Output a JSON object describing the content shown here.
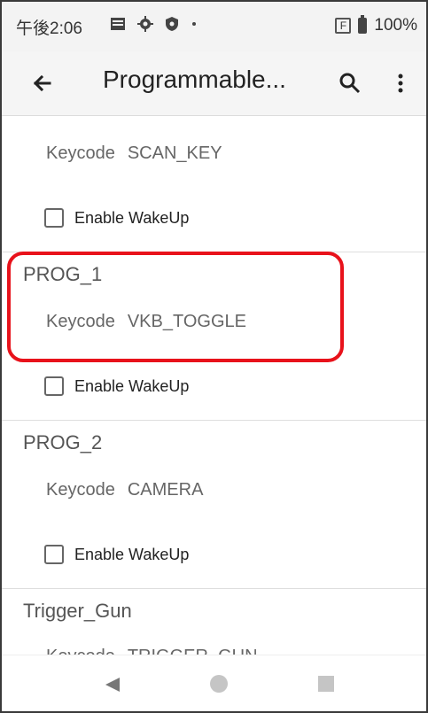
{
  "status_bar": {
    "time": "午後2:06",
    "icons": [
      "image-icon",
      "gear-icon",
      "shield-icon",
      "dot-icon"
    ],
    "f_badge": "F",
    "battery": "100%"
  },
  "app_bar": {
    "title": "Programmable...",
    "back_icon": "arrow-left-icon",
    "search_icon": "search-icon",
    "more_icon": "more-vertical-icon"
  },
  "sections": [
    {
      "header": "",
      "keycode_label": "Keycode",
      "keycode_value": "SCAN_KEY",
      "checkbox_label": "Enable WakeUp",
      "checked": false
    },
    {
      "header": "PROG_1",
      "keycode_label": "Keycode",
      "keycode_value": "VKB_TOGGLE",
      "checkbox_label": "Enable WakeUp",
      "checked": false
    },
    {
      "header": "PROG_2",
      "keycode_label": "Keycode",
      "keycode_value": "CAMERA",
      "checkbox_label": "Enable WakeUp",
      "checked": false
    },
    {
      "header": "Trigger_Gun",
      "keycode_label": "Keycode",
      "keycode_value": "TRIGGER_GUN",
      "checkbox_label": "",
      "checked": false
    }
  ],
  "colors": {
    "highlight": "#e8121b"
  }
}
